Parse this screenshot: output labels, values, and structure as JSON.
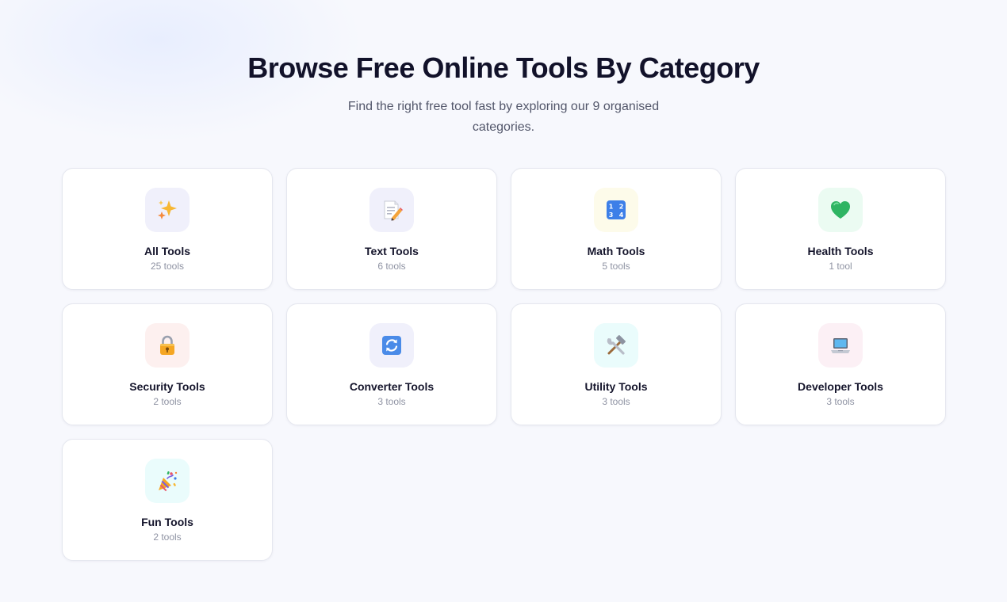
{
  "header": {
    "title": "Browse Free Online Tools By Category",
    "subtitle": "Find the right free tool fast by exploring our 9 organised categories."
  },
  "categories": [
    {
      "name": "All Tools",
      "count": "25 tools",
      "icon": "sparkles-icon",
      "tint": "#f0f0fb"
    },
    {
      "name": "Text Tools",
      "count": "6 tools",
      "icon": "memo-pencil-icon",
      "tint": "#f0f0fb"
    },
    {
      "name": "Math Tools",
      "count": "5 tools",
      "icon": "numbers-1234-icon",
      "tint": "#fdfbea"
    },
    {
      "name": "Health Tools",
      "count": "1 tool",
      "icon": "green-heart-icon",
      "tint": "#ebfbf2"
    },
    {
      "name": "Security Tools",
      "count": "2 tools",
      "icon": "padlock-icon",
      "tint": "#fdf0ef"
    },
    {
      "name": "Converter Tools",
      "count": "3 tools",
      "icon": "refresh-arrows-icon",
      "tint": "#f0f0fb"
    },
    {
      "name": "Utility Tools",
      "count": "3 tools",
      "icon": "hammer-wrench-icon",
      "tint": "#eafcfc"
    },
    {
      "name": "Developer Tools",
      "count": "3 tools",
      "icon": "laptop-icon",
      "tint": "#fcf0f5"
    },
    {
      "name": "Fun Tools",
      "count": "2 tools",
      "icon": "party-popper-icon",
      "tint": "#eafcfc"
    }
  ]
}
